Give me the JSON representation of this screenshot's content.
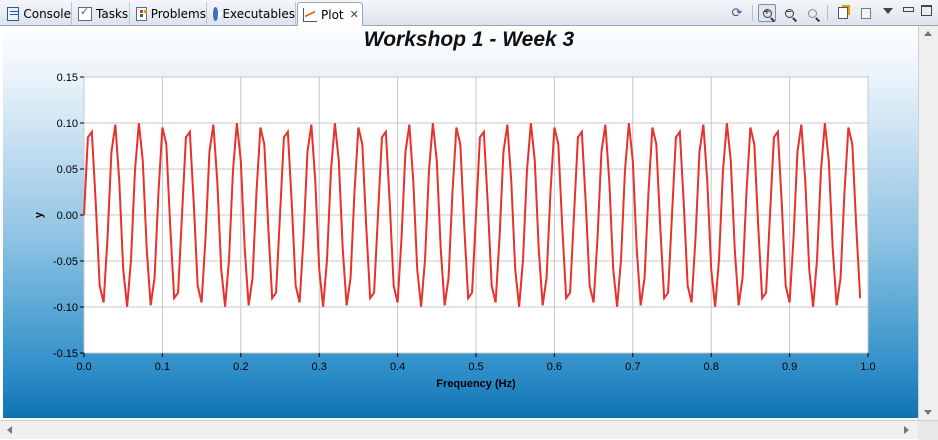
{
  "tabs": [
    {
      "label": "Console",
      "icon": "console-icon"
    },
    {
      "label": "Tasks",
      "icon": "tasks-icon"
    },
    {
      "label": "Problems",
      "icon": "problems-icon"
    },
    {
      "label": "Executables",
      "icon": "executables-icon"
    },
    {
      "label": "Plot",
      "icon": "plot-icon",
      "active": true
    }
  ],
  "toolbar": {
    "buttons": [
      "refresh-icon",
      "zoom-in-icon",
      "zoom-out-icon",
      "zoom-fit-icon",
      "new-plot-icon",
      "export-icon",
      "view-menu-icon",
      "minimize-icon",
      "maximize-icon"
    ]
  },
  "plot": {
    "title": "Workshop 1 - Week 3"
  },
  "chart_data": {
    "type": "line",
    "title": "Workshop 1 - Week 3",
    "xlabel": "Frequency (Hz)",
    "ylabel": "y",
    "xlim": [
      0.0,
      1.0
    ],
    "ylim": [
      -0.15,
      0.15
    ],
    "xticks": [
      "0.0",
      "0.1",
      "0.2",
      "0.3",
      "0.4",
      "0.5",
      "0.6",
      "0.7",
      "0.8",
      "0.9",
      "1.0"
    ],
    "yticks": [
      "0.15",
      "0.10",
      "0.05",
      "0.00",
      "-0.05",
      "-0.10",
      "-0.15"
    ],
    "grid": true,
    "series": [
      {
        "color": "#e8302c",
        "function": "0.1*sin(2*pi*32*x)",
        "amplitude": 0.1,
        "cycles_per_unit_x": 32,
        "x_start": 0.0,
        "x_end": 0.99,
        "x_step": 0.005
      }
    ]
  }
}
